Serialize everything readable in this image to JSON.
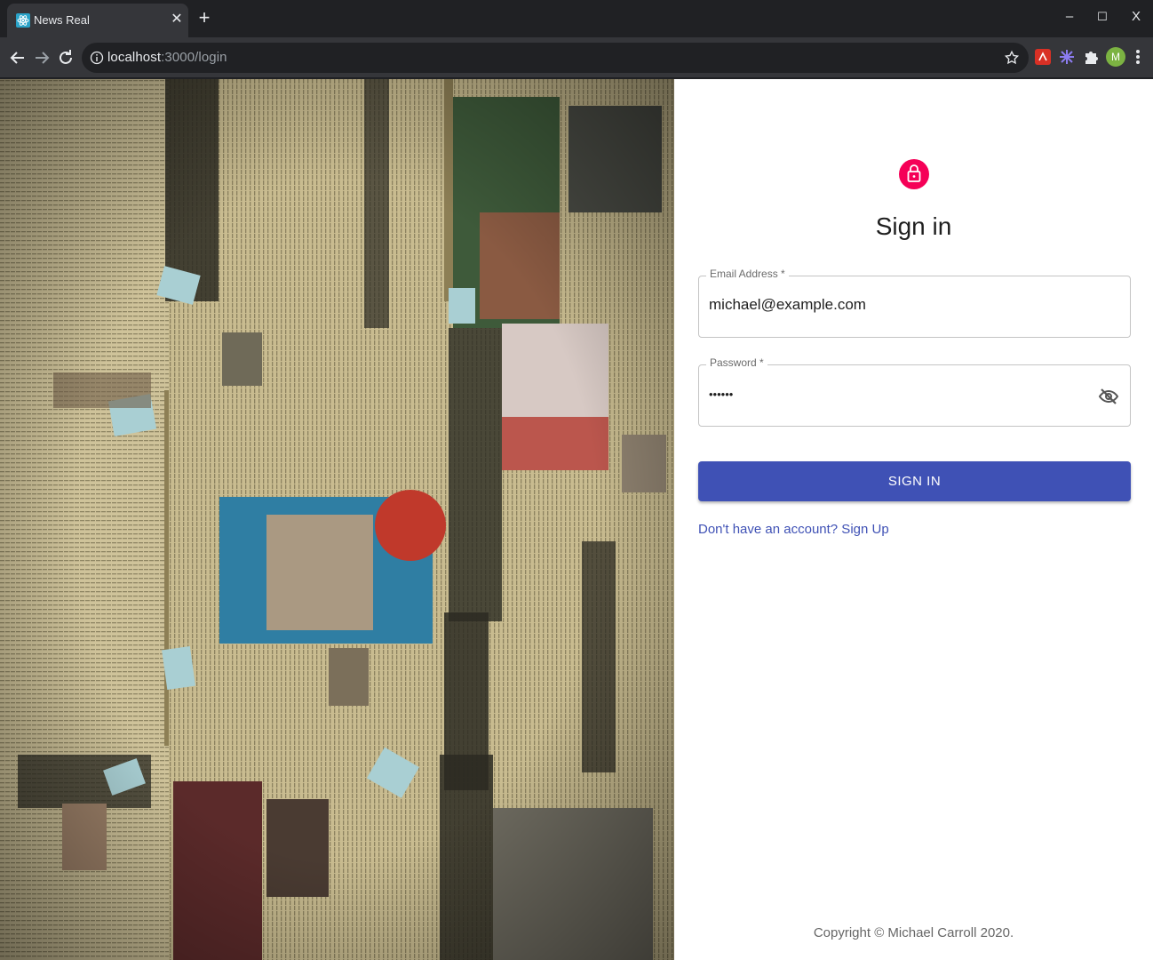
{
  "browser": {
    "tab_title": "News Real",
    "url_host": "localhost",
    "url_rest": ":3000/login",
    "avatar_letter": "M",
    "icons": {
      "favicon": "react-icon",
      "close": "close-icon",
      "new_tab": "plus-icon",
      "back": "back-arrow-icon",
      "forward": "forward-arrow-icon",
      "reload": "reload-icon",
      "info": "info-icon",
      "bookmark": "star-icon",
      "extensions": "puzzle-icon",
      "menu": "kebab-menu-icon"
    },
    "window_controls": {
      "minimize": "–",
      "maximize": "☐",
      "close": "X"
    }
  },
  "hero": {
    "image": "newspaper-collage"
  },
  "signin": {
    "title": "Sign in",
    "email_label": "Email Address *",
    "email_value": "michael@example.com",
    "password_label": "Password *",
    "password_value": "••••••",
    "button_label": "SIGN IN",
    "signup_link": "Don't have an account? Sign Up",
    "lock_icon": "lock-icon",
    "visibility_icon": "visibility-off-icon",
    "colors": {
      "avatar": "#f50057",
      "primary": "#3f51b5"
    }
  },
  "footer": {
    "copyright": "Copyright © Michael Carroll 2020."
  }
}
